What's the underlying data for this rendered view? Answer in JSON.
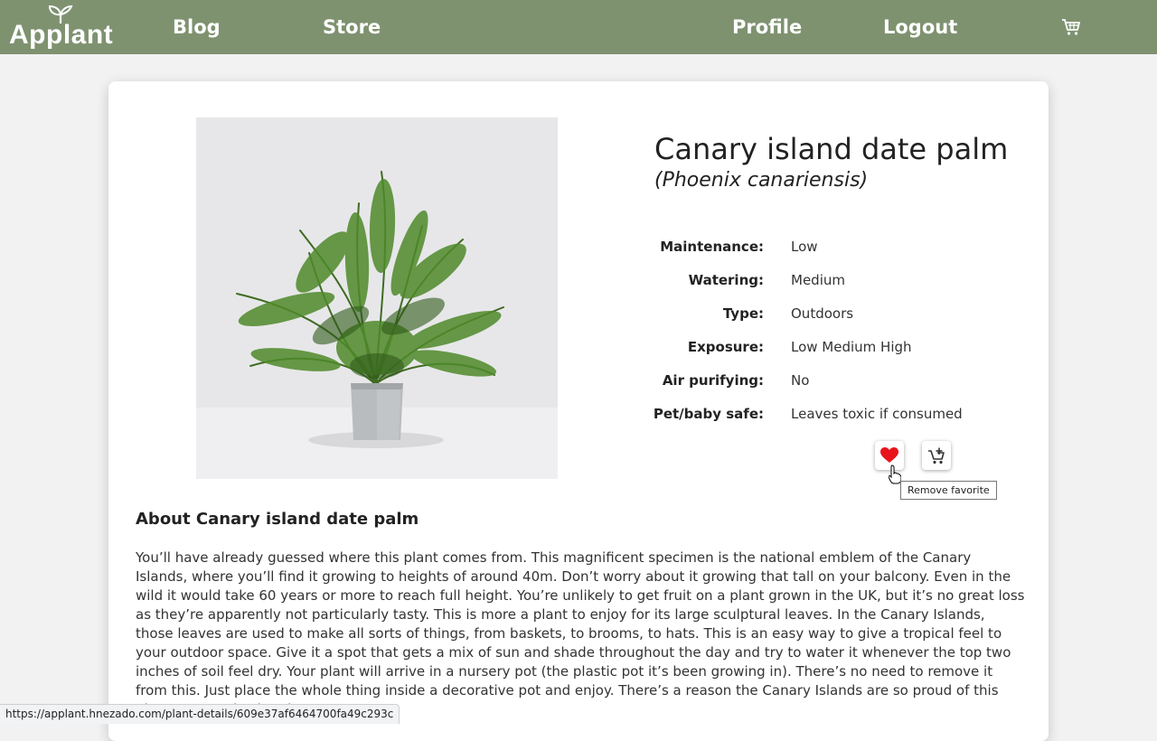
{
  "nav": {
    "logo_text": "Applant",
    "links": {
      "blog": "Blog",
      "store": "Store",
      "profile": "Profile",
      "logout": "Logout"
    },
    "cart_icon": "cart-icon"
  },
  "plant": {
    "name": "Canary island date palm",
    "scientific_name": "(Phoenix canariensis)",
    "specs": [
      {
        "label": "Maintenance:",
        "value": "Low"
      },
      {
        "label": "Watering:",
        "value": "Medium"
      },
      {
        "label": "Type:",
        "value": "Outdoors"
      },
      {
        "label": "Exposure:",
        "value": "Low Medium High"
      },
      {
        "label": "Air purifying:",
        "value": "No"
      },
      {
        "label": "Pet/baby safe:",
        "value": "Leaves toxic if consumed"
      }
    ],
    "actions": {
      "favorite_icon": "heart-icon",
      "add_to_cart_icon": "cart-plus-icon",
      "favorite_tooltip": "Remove favorite"
    },
    "about_title": "About Canary island date palm",
    "about_text": "You’ll have already guessed where this plant comes from. This magnificent specimen is the national emblem of the Canary Islands, where you’ll find it growing to heights of around 40m. Don’t worry about it growing that tall on your balcony. Even in the wild it would take 60 years or more to reach full height. You’re unlikely to get fruit on a plant grown in the UK, but it’s no great loss as they’re apparently not particularly tasty. This is more a plant to enjoy for its large sculptural leaves. In the Canary Islands, those leaves are used to make all sorts of things, from baskets, to brooms, to hats. This is an easy way to give a tropical feel to your outdoor space. Give it a spot that gets a mix of sun and shade throughout the day and try to water it whenever the top two inches of soil feel dry. Your plant will arrive in a nursery pot (the plastic pot it’s been growing in). There’s no need to remove it from this. Just place the whole thing inside a decorative pot and enjoy. There’s a reason the Canary Islands are so proud of this plant. It’s an absolute beauty."
  },
  "statusbar": {
    "url": "https://applant.hnezado.com/plant-details/609e37af6464700fa49c293c"
  },
  "colors": {
    "nav_bg": "#7e9270",
    "page_bg": "#f2f2f2",
    "heart": "#e8141c"
  }
}
